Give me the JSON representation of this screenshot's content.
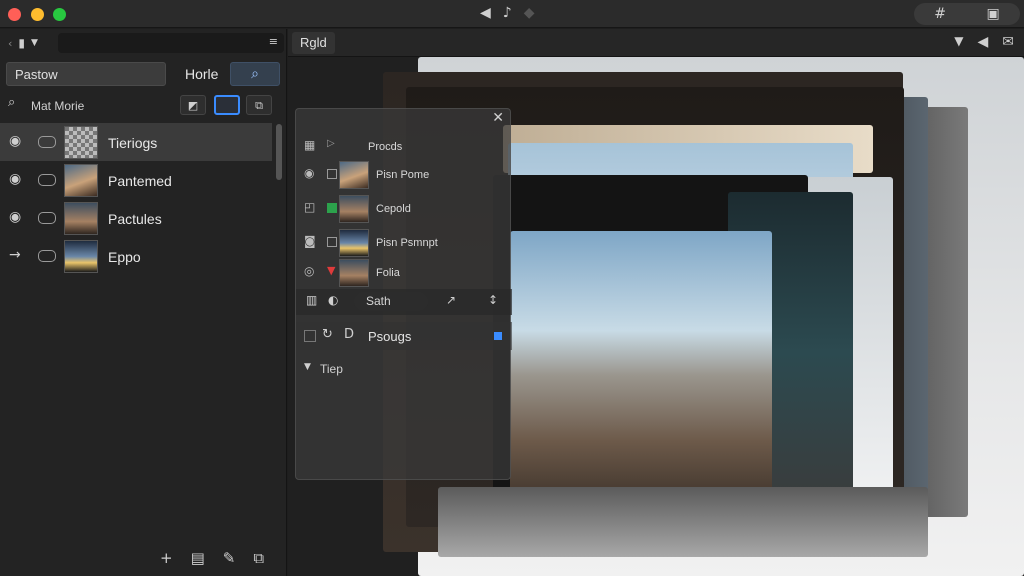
{
  "titlebar": {
    "center_icons": [
      "speaker-icon",
      "tone-icon",
      "diamond-icon"
    ],
    "right_icons": [
      "hash-icon",
      "edit-icon"
    ]
  },
  "left_panel": {
    "preset_value": "Pastow",
    "horle_label": "Horle",
    "filter_label": "Mat Morie",
    "layers": [
      {
        "name": "Tieriogs",
        "selected": true
      },
      {
        "name": "Pantemed",
        "selected": false
      },
      {
        "name": "Pactules",
        "selected": false
      },
      {
        "name": "Eppo",
        "selected": false
      }
    ]
  },
  "tabbar": {
    "tab_label": "Rgld"
  },
  "float_panel": {
    "header_label": "Procds",
    "items": [
      {
        "name": "Pisn Pome"
      },
      {
        "name": "Cepold"
      },
      {
        "name": "Pisn Psmnpt"
      },
      {
        "name": "Folia"
      }
    ],
    "search_label": "Sath",
    "property_label": "Psougs",
    "section_label": "Tiep"
  },
  "colors": {
    "accent": "#3a8cff",
    "background": "#1e1e1e",
    "panel": "#232323"
  }
}
